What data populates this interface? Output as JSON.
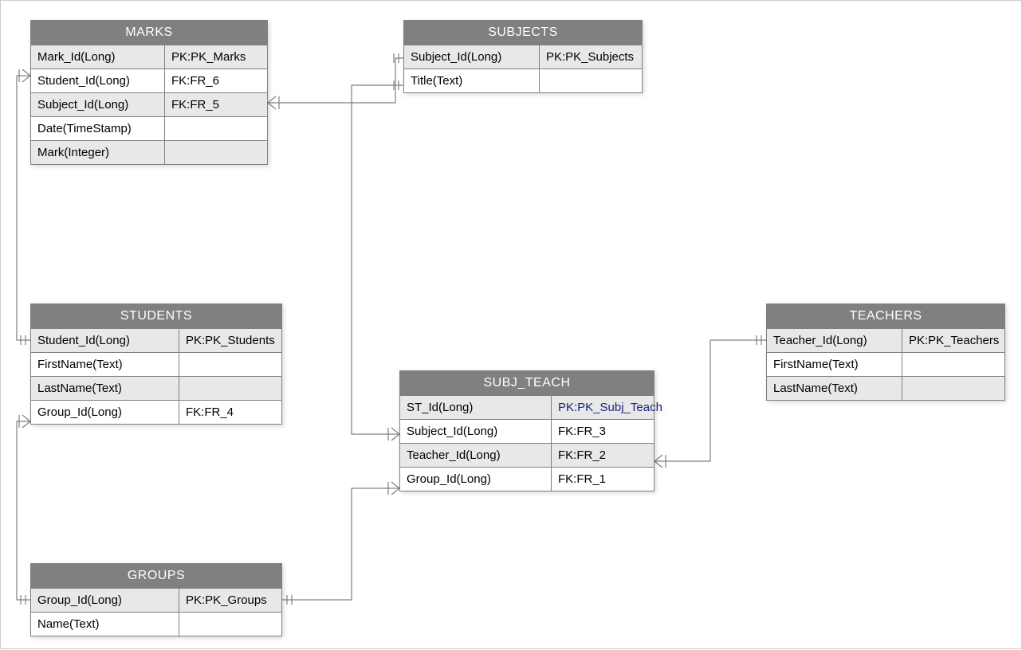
{
  "entities": {
    "marks": {
      "title": "MARKS",
      "rows": [
        {
          "name": "Mark_Id(Long)",
          "key": "PK:PK_Marks",
          "alt": true
        },
        {
          "name": "Student_Id(Long)",
          "key": "FK:FR_6",
          "alt": false
        },
        {
          "name": "Subject_Id(Long)",
          "key": "FK:FR_5",
          "alt": true
        },
        {
          "name": "Date(TimeStamp)",
          "key": "",
          "alt": false
        },
        {
          "name": "Mark(Integer)",
          "key": "",
          "alt": true
        }
      ]
    },
    "subjects": {
      "title": "SUBJECTS",
      "rows": [
        {
          "name": "Subject_Id(Long)",
          "key": "PK:PK_Subjects",
          "alt": true
        },
        {
          "name": "Title(Text)",
          "key": "",
          "alt": false
        }
      ]
    },
    "students": {
      "title": "STUDENTS",
      "rows": [
        {
          "name": "Student_Id(Long)",
          "key": "PK:PK_Students",
          "alt": true
        },
        {
          "name": "FirstName(Text)",
          "key": "",
          "alt": false
        },
        {
          "name": "LastName(Text)",
          "key": "",
          "alt": true
        },
        {
          "name": "Group_Id(Long)",
          "key": "FK:FR_4",
          "alt": false
        }
      ]
    },
    "subj_teach": {
      "title": "SUBJ_TEACH",
      "rows": [
        {
          "name": "ST_Id(Long)",
          "key": "PK:PK_Subj_Teach",
          "alt": true,
          "selected": true
        },
        {
          "name": "Subject_Id(Long)",
          "key": "FK:FR_3",
          "alt": false
        },
        {
          "name": "Teacher_Id(Long)",
          "key": "FK:FR_2",
          "alt": true
        },
        {
          "name": "Group_Id(Long)",
          "key": "FK:FR_1",
          "alt": false
        }
      ]
    },
    "teachers": {
      "title": "TEACHERS",
      "rows": [
        {
          "name": "Teacher_Id(Long)",
          "key": "PK:PK_Teachers",
          "alt": true
        },
        {
          "name": "FirstName(Text)",
          "key": "",
          "alt": false
        },
        {
          "name": "LastName(Text)",
          "key": "",
          "alt": true
        }
      ]
    },
    "groups": {
      "title": "GROUPS",
      "rows": [
        {
          "name": "Group_Id(Long)",
          "key": "PK:PK_Groups",
          "alt": true
        },
        {
          "name": "Name(Text)",
          "key": "",
          "alt": false
        }
      ]
    }
  }
}
